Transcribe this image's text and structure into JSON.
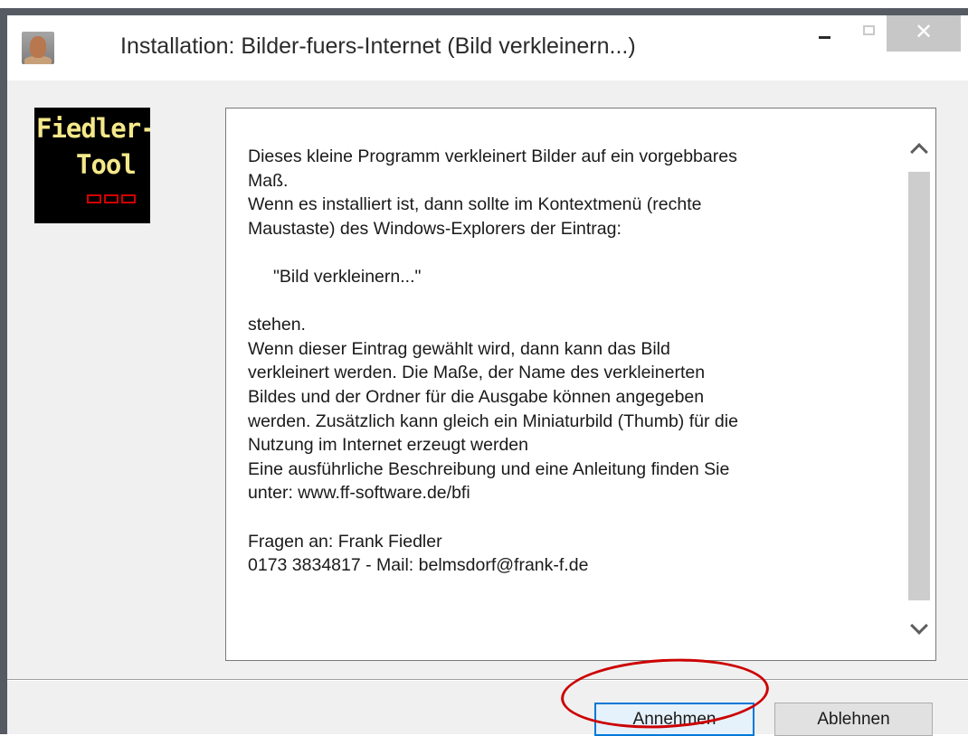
{
  "window": {
    "title": "Installation: Bilder-fuers-Internet (Bild verkleinern...)",
    "controls": {
      "minimize": "minimize-icon",
      "maximize": "maximize-icon",
      "close": "close-icon"
    }
  },
  "logo": {
    "line1": "Fiedler-",
    "line2": "Tool"
  },
  "description": {
    "lines": [
      "Dieses kleine Programm verkleinert Bilder auf ein vorgebbares",
      "Maß.",
      "Wenn es installiert ist, dann sollte im Kontextmenü (rechte",
      "Maustaste) des Windows-Explorers der Eintrag:",
      "",
      "\"Bild verkleinern...\"",
      "",
      "stehen.",
      "Wenn dieser Eintrag gewählt wird, dann kann das Bild",
      "verkleinert werden. Die Maße, der Name des verkleinerten",
      "Bildes und der Ordner für die Ausgabe können angegeben",
      "werden. Zusätzlich kann gleich ein Miniaturbild (Thumb) für die",
      "Nutzung im Internet erzeugt werden",
      "Eine ausführliche Beschreibung und eine Anleitung finden Sie",
      "unter: www.ff-software.de/bfi",
      "",
      "Fragen an: Frank Fiedler",
      "0173 3834817  -  Mail: belmsdorf@frank-f.de"
    ]
  },
  "buttons": {
    "accept": "Annehmen",
    "decline": "Ablehnen"
  },
  "colors": {
    "annotation_circle": "#cc0000",
    "focus_border": "#0078d7"
  }
}
